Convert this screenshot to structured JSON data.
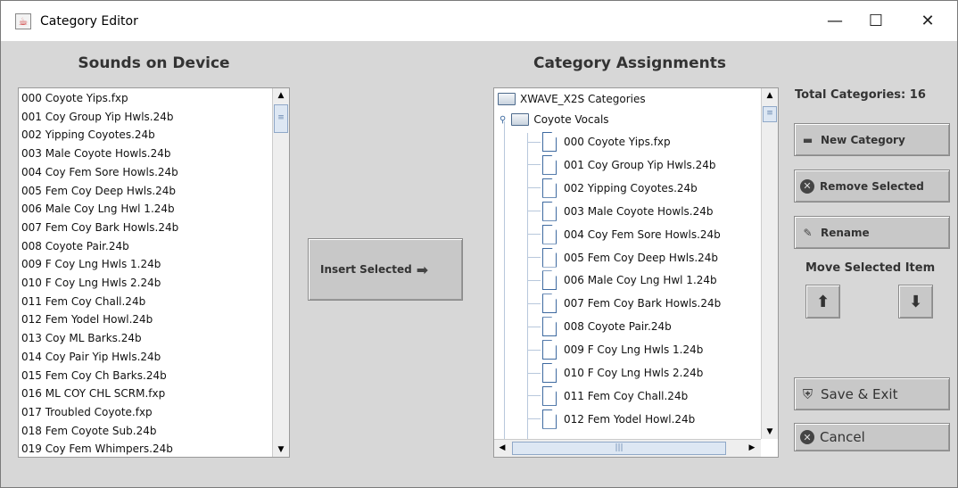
{
  "window": {
    "title": "Category Editor",
    "minimize": "—",
    "maximize": "☐",
    "close": "✕"
  },
  "left": {
    "heading": "Sounds on Device",
    "items": [
      "000 Coyote Yips.fxp",
      "001 Coy Group Yip Hwls.24b",
      "002 Yipping Coyotes.24b",
      "003 Male Coyote Howls.24b",
      "004 Coy Fem Sore Howls.24b",
      "005 Fem Coy Deep Hwls.24b",
      "006 Male Coy Lng Hwl 1.24b",
      "007 Fem Coy Bark Howls.24b",
      "008 Coyote Pair.24b",
      "009 F Coy Lng Hwls 1.24b",
      "010 F Coy Lng Hwls 2.24b",
      "011 Fem Coy Chall.24b",
      "012 Fem Yodel Howl.24b",
      "013 Coy ML Barks.24b",
      "014 Coy Pair Yip Hwls.24b",
      "015 Fem Coy Ch Barks.24b",
      "016 ML COY CHL SCRM.fxp",
      "017 Troubled Coyote.fxp",
      "018 Fem Coyote Sub.24b",
      "019 Coy Fem Whimpers.24b"
    ]
  },
  "insert_button": "Insert Selected",
  "right": {
    "heading": "Category Assignments",
    "root": "XWAVE_X2S Categories",
    "category": "Coyote Vocals",
    "items": [
      "000 Coyote Yips.fxp",
      "001 Coy Group Yip Hwls.24b",
      "002 Yipping Coyotes.24b",
      "003 Male Coyote Howls.24b",
      "004 Coy Fem Sore Howls.24b",
      "005 Fem Coy Deep Hwls.24b",
      "006 Male Coy Lng Hwl 1.24b",
      "007 Fem Coy Bark Howls.24b",
      "008 Coyote Pair.24b",
      "009 F Coy Lng Hwls 1.24b",
      "010 F Coy Lng Hwls 2.24b",
      "011 Fem Coy Chall.24b",
      "012 Fem Yodel Howl.24b"
    ]
  },
  "panel": {
    "total": "Total Categories: 16",
    "new_category": "New Category",
    "remove_selected": "Remove Selected",
    "rename": "Rename",
    "move_label": "Move Selected Item",
    "save_exit": "Save & Exit",
    "cancel": "Cancel"
  }
}
